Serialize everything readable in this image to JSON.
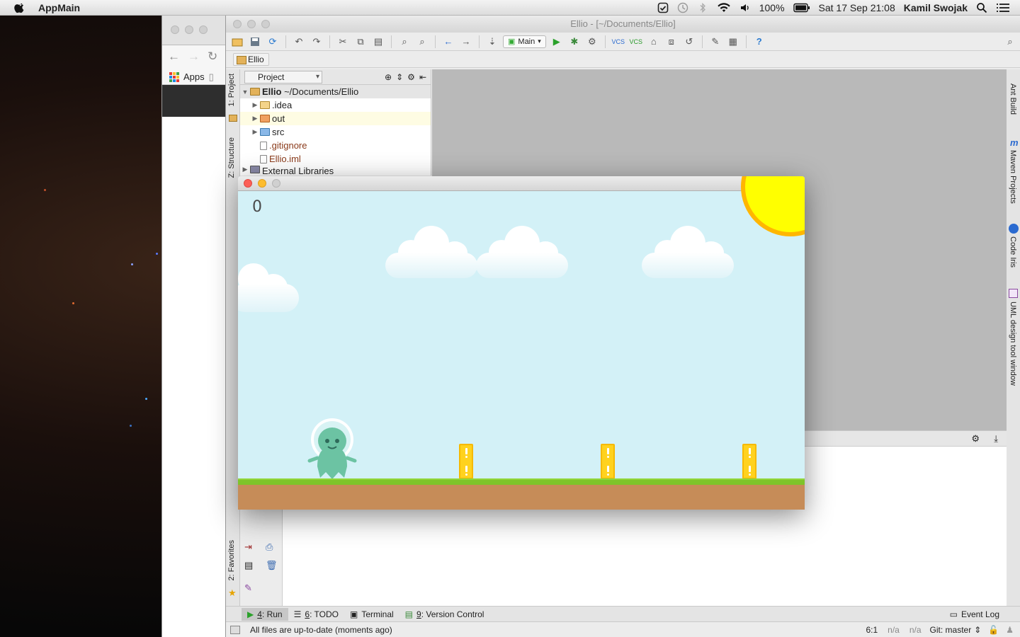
{
  "menubar": {
    "app_name": "AppMain",
    "battery": "100%",
    "datetime": "Sat 17 Sep  21:08",
    "user": "Kamil Swojak"
  },
  "chrome": {
    "bookmarks_apps": "Apps"
  },
  "ide": {
    "title": "Ellio - [~/Documents/Ellio]",
    "run_config": "Main",
    "breadcrumb": "Ellio",
    "left_tabs": {
      "project": "1: Project",
      "structure": "Z: Structure",
      "favorites": "2: Favorites"
    },
    "right_tabs": {
      "ant": "Ant Build",
      "maven": "Maven Projects",
      "codeiris": "Code Iris",
      "uml": "UML design tool window"
    },
    "project_panel": {
      "view_selector": "Project",
      "tree": [
        {
          "name": "Ellio",
          "path": "~/Documents/Ellio"
        },
        {
          "name": ".idea"
        },
        {
          "name": "out"
        },
        {
          "name": "src"
        },
        {
          "name": ".gitignore"
        },
        {
          "name": "Ellio.iml"
        },
        {
          "name": "External Libraries"
        }
      ]
    },
    "bottom_tabs": {
      "run_num": "4",
      "run_label": ": Run",
      "todo_num": "6",
      "todo_label": ": TODO",
      "terminal": "Terminal",
      "vc_num": "9",
      "vc_label": ": Version Control",
      "event_log": "Event Log"
    },
    "status": {
      "message": "All files are up-to-date (moments ago)",
      "position": "6:1",
      "na1": "n/a",
      "na2": "n/a",
      "git": "Git: master"
    }
  },
  "game": {
    "score": "0",
    "colors": {
      "sky": "#d3f1f7",
      "grass": "#7ec42a",
      "dirt": "#c68c58",
      "sun": "#ffff00",
      "pillar": "#ffd21e",
      "player": "#6cc3a3"
    }
  }
}
